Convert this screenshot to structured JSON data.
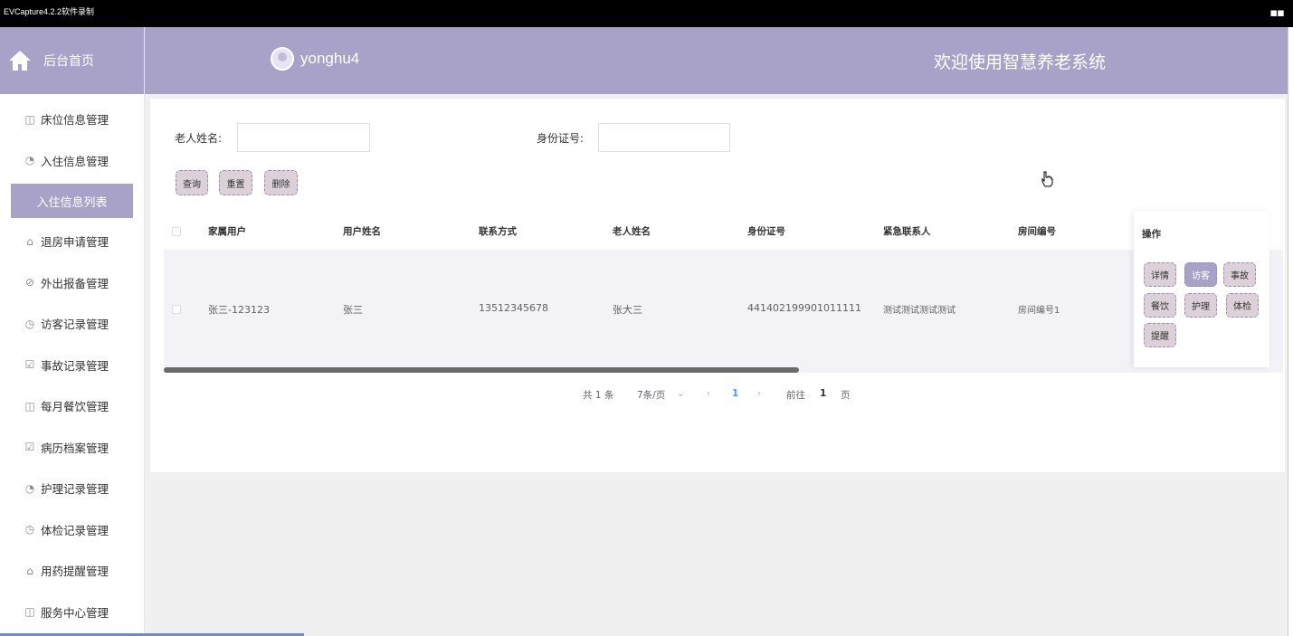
{
  "recorder": {
    "title": "EVCapture4.2.2软件录制"
  },
  "sidebar": {
    "home_label": "后台首页",
    "items": [
      {
        "label": "床位信息管理",
        "icon": "◫"
      },
      {
        "label": "入住信息管理",
        "icon": "◔"
      },
      {
        "label": "退房申请管理",
        "icon": "⌂"
      },
      {
        "label": "外出报备管理",
        "icon": "⊘"
      },
      {
        "label": "访客记录管理",
        "icon": "◷"
      },
      {
        "label": "事故记录管理",
        "icon": "☑"
      },
      {
        "label": "每月餐饮管理",
        "icon": "◫"
      },
      {
        "label": "病历档案管理",
        "icon": "☑"
      },
      {
        "label": "护理记录管理",
        "icon": "◔"
      },
      {
        "label": "体检记录管理",
        "icon": "◷"
      },
      {
        "label": "用药提醒管理",
        "icon": "⌂"
      },
      {
        "label": "服务中心管理",
        "icon": "◫"
      }
    ],
    "active_sub": "入住信息列表"
  },
  "header": {
    "username": "yonghu4",
    "welcome": "欢迎使用智慧养老系统"
  },
  "search": {
    "name_label": "老人姓名:",
    "name_value": "",
    "id_label": "身份证号:",
    "id_value": "",
    "query": "查询",
    "reset": "重置",
    "delete": "删除"
  },
  "table": {
    "columns": [
      "家属用户",
      "用户姓名",
      "联系方式",
      "老人姓名",
      "身份证号",
      "紧急联系人",
      "房间编号"
    ],
    "rows": [
      [
        "张三-123123",
        "张三",
        "13512345678",
        "张大三",
        "441402199901011111",
        "测试测试测试测试",
        "房间编号1"
      ]
    ],
    "ops_header": "操作",
    "ops": [
      "详情",
      "访客",
      "事故",
      "餐饮",
      "护理",
      "体检",
      "提醒"
    ]
  },
  "pager": {
    "total": "共 1 条",
    "page_size": "7条/页",
    "current": "1",
    "goto_prefix": "前往",
    "goto_value": "1",
    "goto_suffix": "页"
  },
  "colors": {
    "accent": "#a8a2c8",
    "button": "#dcd0d9",
    "active_page": "#409eff"
  }
}
